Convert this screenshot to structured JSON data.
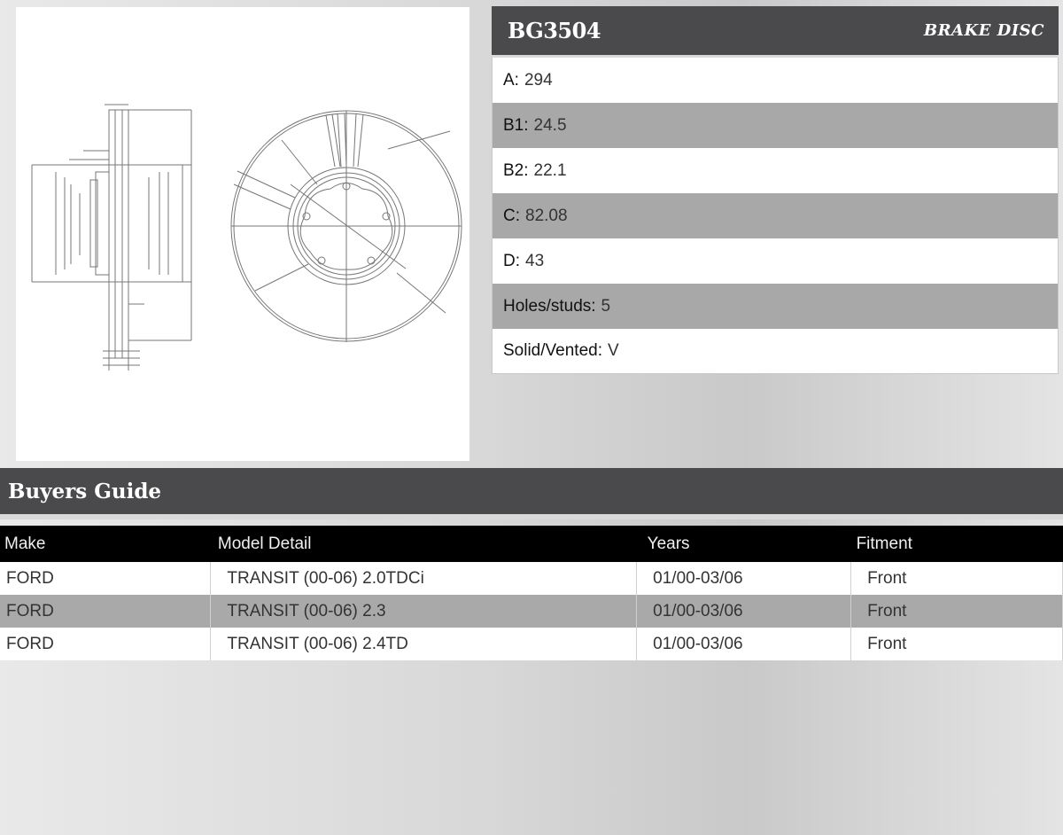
{
  "product": {
    "code": "BG3504",
    "type": "BRAKE DISC",
    "specs": [
      {
        "label": "A:",
        "value": "294"
      },
      {
        "label": "B1:",
        "value": "24.5"
      },
      {
        "label": "B2:",
        "value": "22.1"
      },
      {
        "label": "C:",
        "value": "82.08"
      },
      {
        "label": "D:",
        "value": "43"
      },
      {
        "label": "Holes/studs:",
        "value": "5"
      },
      {
        "label": "Solid/Vented:",
        "value": "V"
      }
    ]
  },
  "buyers_guide": {
    "title": "Buyers Guide",
    "columns": [
      "Make",
      "Model Detail",
      "Years",
      "Fitment"
    ],
    "rows": [
      [
        "FORD",
        "TRANSIT (00-06) 2.0TDCi",
        "01/00-03/06",
        "Front"
      ],
      [
        "FORD",
        "TRANSIT (00-06) 2.3",
        "01/00-03/06",
        "Front"
      ],
      [
        "FORD",
        "TRANSIT (00-06) 2.4TD",
        "01/00-03/06",
        "Front"
      ]
    ]
  },
  "colors": {
    "header_bg": "#4a4a4d",
    "table_header_bg": "#000000",
    "row_alt": "#a9a9a9"
  }
}
